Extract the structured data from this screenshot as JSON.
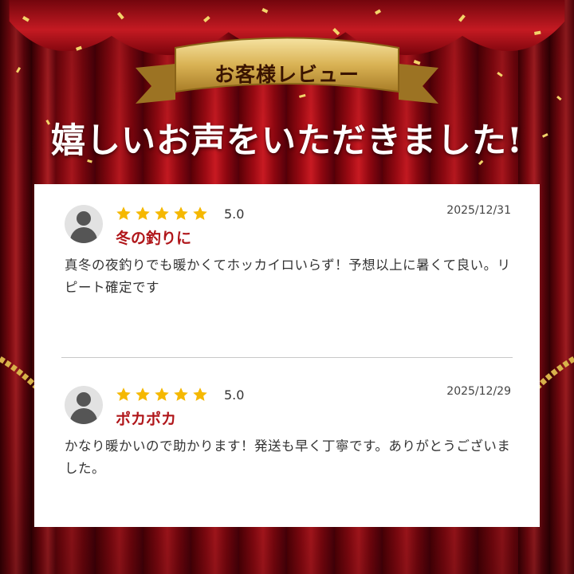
{
  "banner": {
    "label": "お客様レビュー"
  },
  "headline": "嬉しいお声をいただきました!",
  "colors": {
    "curtain": "#b10f18",
    "gold": "#c9a24a",
    "title_red": "#b0161a",
    "star": "#f5b800"
  },
  "reviews": [
    {
      "rating": "5.0",
      "stars": 5,
      "date": "2025/12/31",
      "title": "冬の釣りに",
      "body": "真冬の夜釣りでも暖かくてホッカイロいらず！予想以上に暑くて良い。リピート確定です",
      "avatar_icon": "user-avatar-icon"
    },
    {
      "rating": "5.0",
      "stars": 5,
      "date": "2025/12/29",
      "title": "ポカポカ",
      "body": "かなり暖かいので助かります！発送も早く丁寧です。ありがとうございました。",
      "avatar_icon": "user-avatar-icon"
    }
  ]
}
